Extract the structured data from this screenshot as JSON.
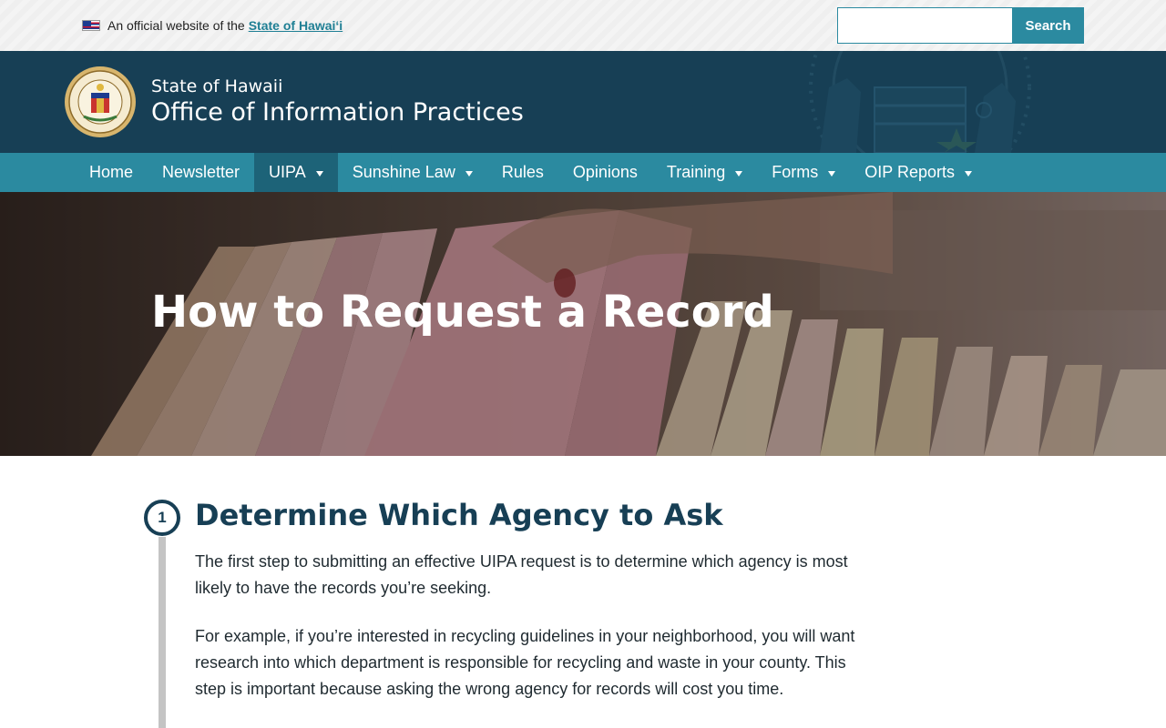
{
  "official_bar": {
    "text": "An official website of the",
    "link": "State of Hawaiʻi"
  },
  "search": {
    "placeholder": "",
    "button": "Search"
  },
  "header": {
    "subtitle": "State of Hawaii",
    "title": "Office of Information Practices"
  },
  "nav": {
    "items": [
      {
        "label": "Home"
      },
      {
        "label": "Newsletter"
      },
      {
        "label": "UIPA"
      },
      {
        "label": "Sunshine Law"
      },
      {
        "label": "Rules"
      },
      {
        "label": "Opinions"
      },
      {
        "label": "Training"
      },
      {
        "label": "Forms"
      },
      {
        "label": "OIP Reports"
      }
    ]
  },
  "hero": {
    "title": "How to Request a Record"
  },
  "step": {
    "number": "1",
    "heading": "Determine Which Agency to Ask",
    "paragraphs": [
      "The first step to submitting an effective UIPA request is to determine which agency is most likely to have the records you’re seeking.",
      "For example, if you’re interested in recycling guidelines in your neighborhood, you will want research into which department is responsible for recycling and waste in your county.  This step is important because asking the wrong agency for records will cost you time."
    ]
  },
  "colors": {
    "header_bg": "#173f55",
    "nav_bg": "#2b8aa0",
    "nav_active": "#1d6378",
    "accent": "#2b8aa0"
  }
}
